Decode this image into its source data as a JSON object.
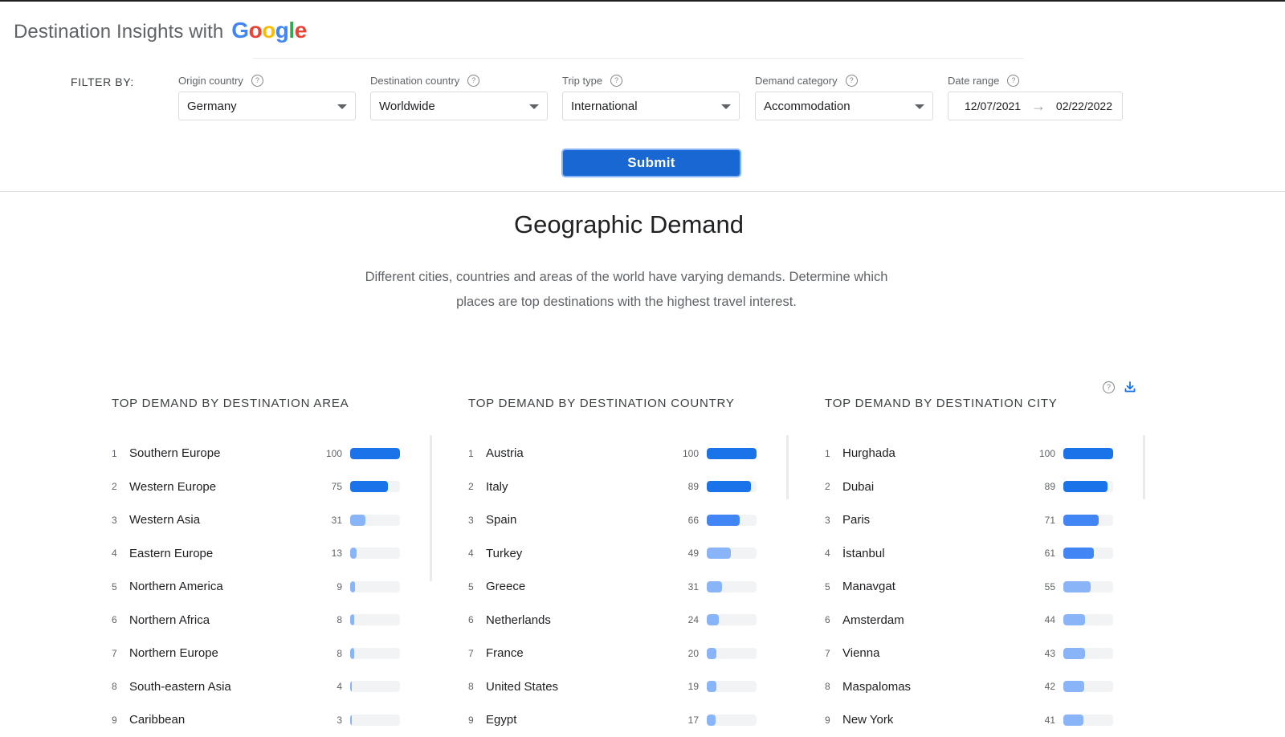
{
  "brand": {
    "text": "Destination Insights with",
    "logo": [
      "G",
      "o",
      "o",
      "g",
      "l",
      "e"
    ]
  },
  "filter_by": "FILTER BY:",
  "filters": [
    {
      "label": "Origin country",
      "value": "Germany"
    },
    {
      "label": "Destination country",
      "value": "Worldwide"
    },
    {
      "label": "Trip type",
      "value": "International"
    },
    {
      "label": "Demand category",
      "value": "Accommodation"
    }
  ],
  "date_range": {
    "label": "Date range",
    "start": "12/07/2021",
    "end": "02/22/2022"
  },
  "submit_label": "Submit",
  "section": {
    "title": "Geographic Demand",
    "desc": "Different cities, countries and areas of the world have varying demands. Determine which places are top destinations with the highest travel interest."
  },
  "colors": {
    "bar_strong": "#1a73e8",
    "bar_mid": "#4285f4",
    "bar_light": "#8ab4f8",
    "track": "#f1f3f4"
  },
  "panels": [
    {
      "title": "TOP DEMAND BY DESTINATION AREA",
      "rows": [
        {
          "rank": "1",
          "name": "Southern Europe",
          "value": 100
        },
        {
          "rank": "2",
          "name": "Western Europe",
          "value": 75
        },
        {
          "rank": "3",
          "name": "Western Asia",
          "value": 31
        },
        {
          "rank": "4",
          "name": "Eastern Europe",
          "value": 13
        },
        {
          "rank": "5",
          "name": "Northern America",
          "value": 9
        },
        {
          "rank": "6",
          "name": "Northern Africa",
          "value": 8
        },
        {
          "rank": "7",
          "name": "Northern Europe",
          "value": 8
        },
        {
          "rank": "8",
          "name": "South-eastern Asia",
          "value": 4
        },
        {
          "rank": "9",
          "name": "Caribbean",
          "value": 3
        }
      ]
    },
    {
      "title": "TOP DEMAND BY DESTINATION COUNTRY",
      "rows": [
        {
          "rank": "1",
          "name": "Austria",
          "value": 100
        },
        {
          "rank": "2",
          "name": "Italy",
          "value": 89
        },
        {
          "rank": "3",
          "name": "Spain",
          "value": 66
        },
        {
          "rank": "4",
          "name": "Turkey",
          "value": 49
        },
        {
          "rank": "5",
          "name": "Greece",
          "value": 31
        },
        {
          "rank": "6",
          "name": "Netherlands",
          "value": 24
        },
        {
          "rank": "7",
          "name": "France",
          "value": 20
        },
        {
          "rank": "8",
          "name": "United States",
          "value": 19
        },
        {
          "rank": "9",
          "name": "Egypt",
          "value": 17
        }
      ]
    },
    {
      "title": "TOP DEMAND BY DESTINATION CITY",
      "rows": [
        {
          "rank": "1",
          "name": "Hurghada",
          "value": 100
        },
        {
          "rank": "2",
          "name": "Dubai",
          "value": 89
        },
        {
          "rank": "3",
          "name": "Paris",
          "value": 71
        },
        {
          "rank": "4",
          "name": "İstanbul",
          "value": 61
        },
        {
          "rank": "5",
          "name": "Manavgat",
          "value": 55
        },
        {
          "rank": "6",
          "name": "Amsterdam",
          "value": 44
        },
        {
          "rank": "7",
          "name": "Vienna",
          "value": 43
        },
        {
          "rank": "8",
          "name": "Maspalomas",
          "value": 42
        },
        {
          "rank": "9",
          "name": "New York",
          "value": 41
        }
      ]
    }
  ]
}
